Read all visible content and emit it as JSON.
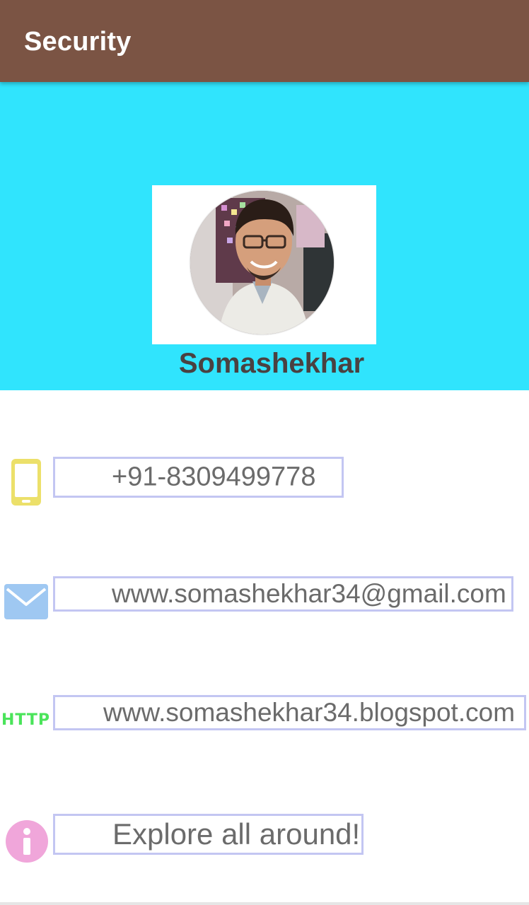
{
  "app_bar": {
    "title": "Security"
  },
  "profile": {
    "name": "Somashekhar"
  },
  "contacts": {
    "phone": {
      "icon": "smartphone-icon",
      "value": "+91-8309499778",
      "icon_color": "#ece06a"
    },
    "email": {
      "icon": "mail-icon",
      "value": "www.somashekhar34@gmail.com",
      "icon_color": "#9fc8f2"
    },
    "website": {
      "icon": "http-icon",
      "icon_label": "HTTP",
      "value": "www.somashekhar34.blogspot.com",
      "icon_color": "#4ae45a"
    },
    "about": {
      "icon": "info-icon",
      "value": "Explore all around!",
      "icon_color": "#f0a6da"
    }
  },
  "colors": {
    "app_bar": "#7b5444",
    "header_panel": "#30e4fd",
    "field_border": "#c3c6f2"
  }
}
